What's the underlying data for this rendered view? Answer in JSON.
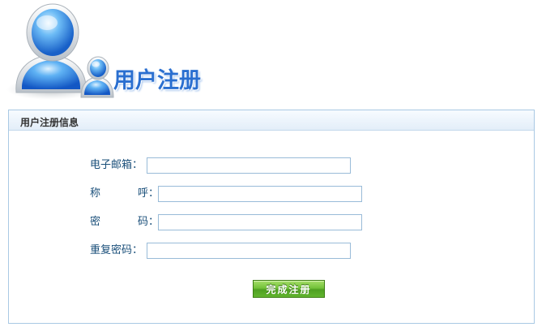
{
  "header": {
    "title": "用户注册"
  },
  "panel": {
    "title": "用户注册信息"
  },
  "form": {
    "email": {
      "label": "电子邮箱：",
      "value": ""
    },
    "nickname": {
      "label_left": "称",
      "label_right": "呼：",
      "value": ""
    },
    "password": {
      "label_left": "密",
      "label_right": "码：",
      "value": ""
    },
    "confirm_password": {
      "label": "重复密码：",
      "value": ""
    },
    "submit_label": "完成注册"
  },
  "colors": {
    "title_blue": "#2a6fd0",
    "label_blue": "#1a4f7a",
    "button_green": "#62b52f",
    "panel_border": "#a9c9e4"
  },
  "icons": {
    "logo": "user-group-icon"
  }
}
